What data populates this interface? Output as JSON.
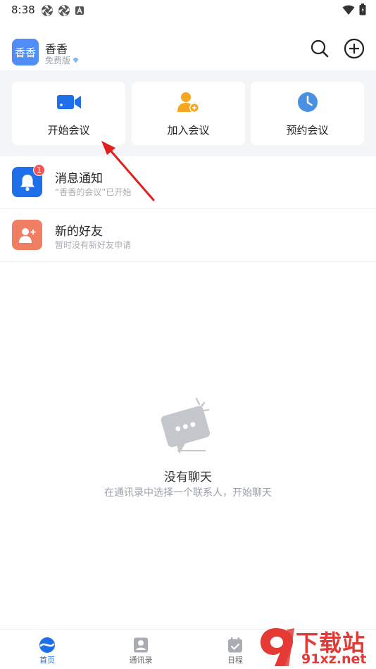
{
  "status_bar": {
    "time": "8:38"
  },
  "header": {
    "avatar_text": "香香",
    "user_name": "香香",
    "plan": "免费版"
  },
  "quick_actions": [
    {
      "label": "开始会议",
      "icon": "video-camera-icon",
      "color": "#1f6feb"
    },
    {
      "label": "加入会议",
      "icon": "add-person-icon",
      "color": "#f5a623"
    },
    {
      "label": "预约会议",
      "icon": "clock-icon",
      "color": "#4a90e2"
    }
  ],
  "list": [
    {
      "title": "消息通知",
      "subtitle": "“香香的会议”已开始",
      "badge": "1",
      "icon": "bell-icon",
      "color": "#1f6feb"
    },
    {
      "title": "新的好友",
      "subtitle": "暂时没有新好友申请",
      "icon": "friend-add-icon",
      "color": "#ef7e63"
    }
  ],
  "empty_state": {
    "title": "没有聊天",
    "subtitle": "在通讯录中选择一个联系人，开始聊天"
  },
  "tabs": [
    {
      "label": "首页",
      "active": true
    },
    {
      "label": "通讯录",
      "active": false
    },
    {
      "label": "日程",
      "active": false
    }
  ],
  "watermark": {
    "top": "下载站",
    "bottom": "91xz.net"
  },
  "colors": {
    "primary": "#1f6feb",
    "accent_orange": "#f5a623",
    "friend": "#ef7e63",
    "badge": "#f25555",
    "annotation": "#e02020"
  }
}
